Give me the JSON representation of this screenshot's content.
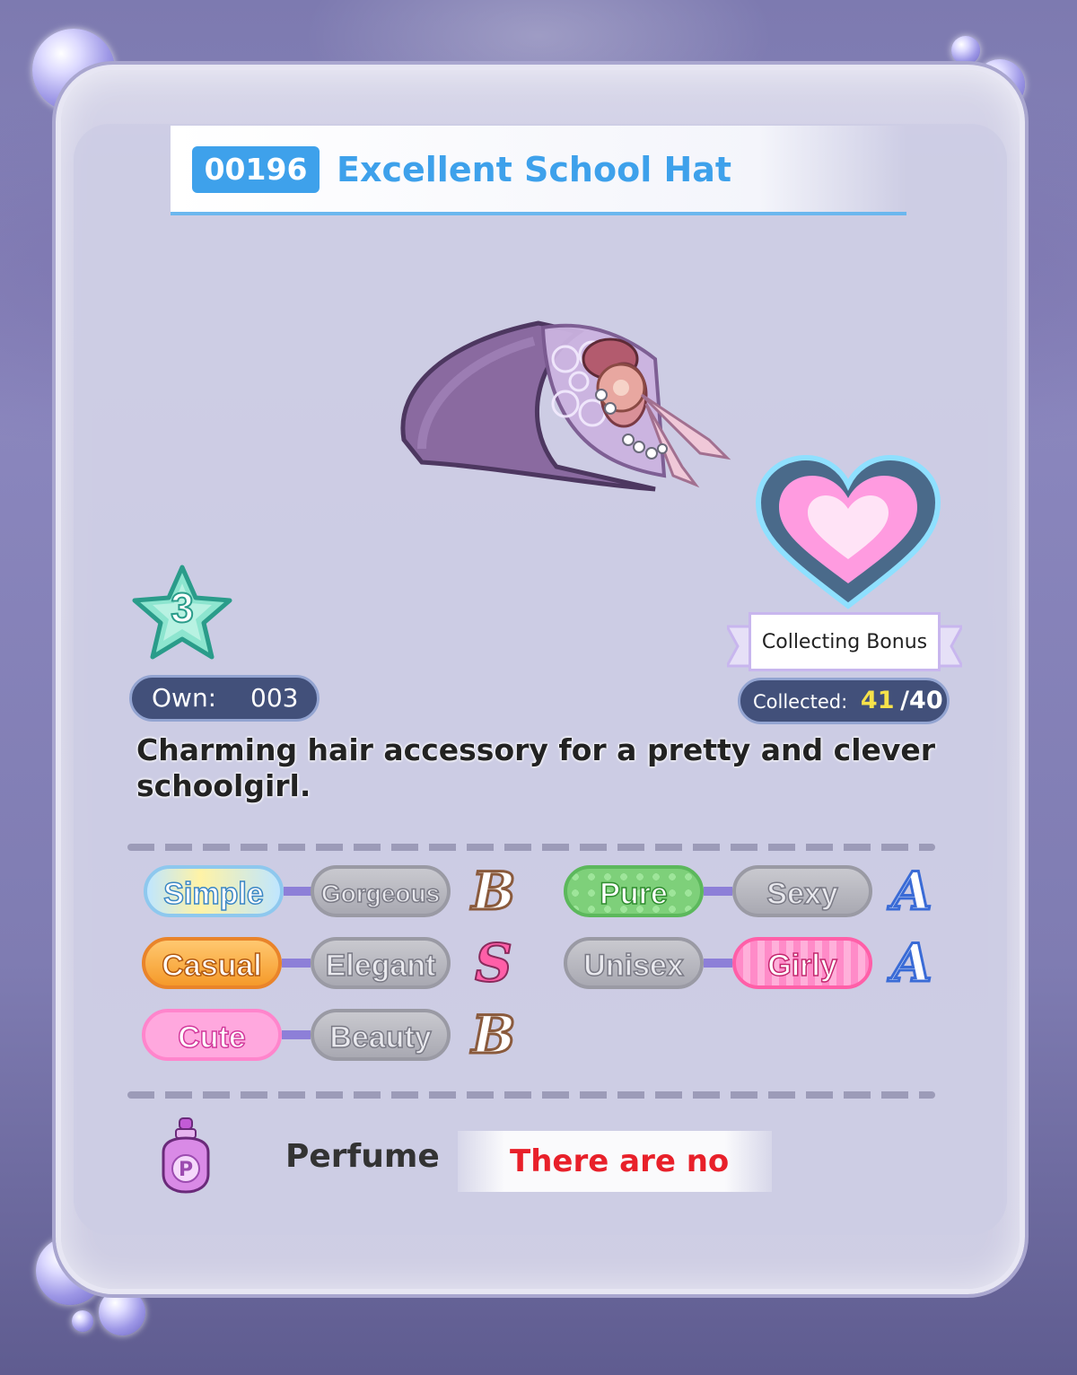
{
  "item": {
    "id": "00196",
    "name": "Excellent School Hat",
    "rarity": "3",
    "own_label": "Own:",
    "own_count": "003",
    "description": "Charming hair accessory for a pretty and clever schoolgirl."
  },
  "bonus": {
    "label": "Collecting Bonus",
    "collected_label": "Collected:",
    "collected": "41",
    "separator": "/",
    "total": "40"
  },
  "styles": [
    {
      "left": "Simple",
      "right": "Gorgeous",
      "active": "Simple",
      "grade": "B"
    },
    {
      "left": "Casual",
      "right": "Elegant",
      "active": "Casual",
      "grade": "S"
    },
    {
      "left": "Cute",
      "right": "Beauty",
      "active": "Cute",
      "grade": "B"
    },
    {
      "left": "Pure",
      "right": "Sexy",
      "active": "Pure",
      "grade": "A"
    },
    {
      "left": "Unisex",
      "right": "Girly",
      "active": "Girly",
      "grade": "A"
    }
  ],
  "perfume": {
    "label": "Perfume",
    "value": "There are no"
  },
  "colors": {
    "id_badge": "#3ea1eb",
    "title": "#3ea1eb",
    "collected_value": "#f7e24a",
    "perfume_value": "#e8202a"
  }
}
